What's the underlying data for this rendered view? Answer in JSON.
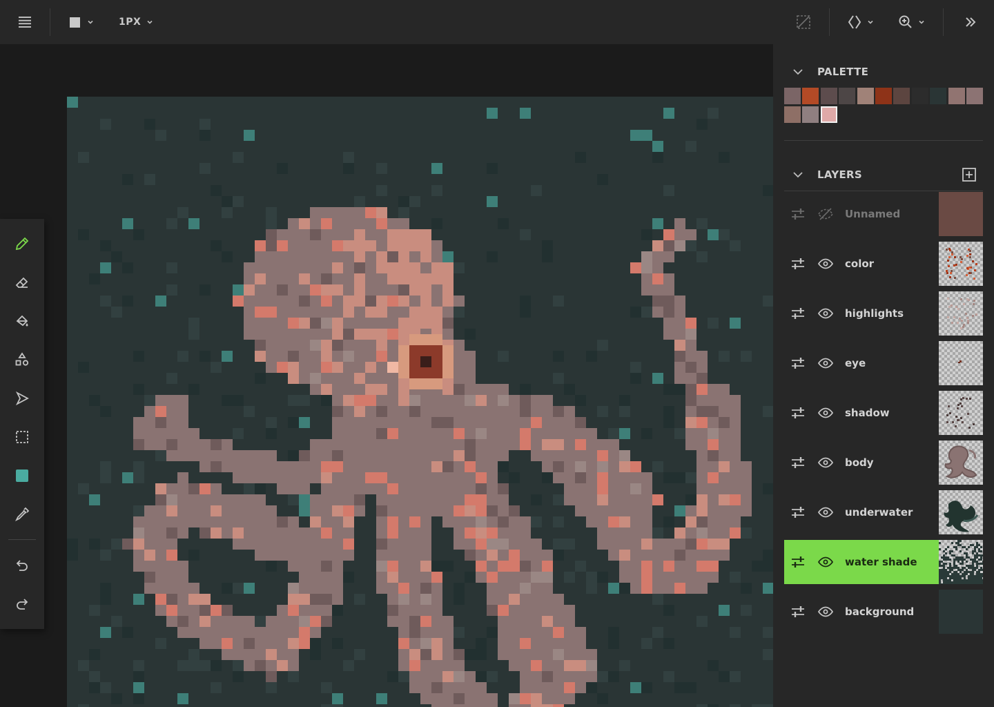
{
  "topbar": {
    "menu_icon": "hamburger-menu-icon",
    "brush_shape_icon": "square-brush-icon",
    "brush_size_label": "1PX",
    "transparency_icon": "transparency-grid-icon",
    "symmetry_icon": "mirror-symmetry-icon",
    "zoom_icon": "zoom-in-icon",
    "collapse_icon": "double-chevron-right-icon"
  },
  "tools": [
    {
      "name": "pencil-tool",
      "icon": "pencil-icon",
      "active": true
    },
    {
      "name": "eraser-tool",
      "icon": "eraser-icon"
    },
    {
      "name": "fill-tool",
      "icon": "paint-bucket-icon"
    },
    {
      "name": "shapes-tool",
      "icon": "shapes-icon"
    },
    {
      "name": "move-tool",
      "icon": "cursor-arrow-icon"
    },
    {
      "name": "selection-tool",
      "icon": "marquee-selection-icon"
    },
    {
      "name": "color-tool",
      "icon": "color-swatch-icon"
    },
    {
      "name": "eyedropper-tool",
      "icon": "eyedropper-icon"
    },
    {
      "name": "undo-button",
      "icon": "undo-icon"
    },
    {
      "name": "redo-button",
      "icon": "redo-icon"
    }
  ],
  "palette": {
    "title": "PALETTE",
    "colors": [
      "#7b6566",
      "#b34a26",
      "#5d4c4d",
      "#4d4646",
      "#a08278",
      "#8e3318",
      "#5c4540",
      "#2c2c2c",
      "#2a3535",
      "#917471",
      "#8c7373",
      "#8e6f66",
      "#8f7f80",
      "#dfa9a8"
    ],
    "selected_index": 13
  },
  "layers": {
    "title": "LAYERS",
    "add_icon": "add-layer-icon",
    "items": [
      {
        "name": "Unnamed",
        "visible": false,
        "thumb": "solid"
      },
      {
        "name": "color",
        "visible": true,
        "thumb": "color"
      },
      {
        "name": "highlights",
        "visible": true,
        "thumb": "highlights"
      },
      {
        "name": "eye",
        "visible": true,
        "thumb": "eye"
      },
      {
        "name": "shadow",
        "visible": true,
        "thumb": "shadow"
      },
      {
        "name": "body",
        "visible": true,
        "thumb": "body"
      },
      {
        "name": "underwater",
        "visible": true,
        "thumb": "underwater"
      },
      {
        "name": "water shade",
        "visible": true,
        "thumb": "watershade",
        "active": true
      },
      {
        "name": "background",
        "visible": true,
        "thumb": "background"
      }
    ]
  },
  "colors": {
    "accent": "#7bd94a",
    "canvas_bg": "#2a3535",
    "octopus_body": "#8a7372",
    "octopus_skin_light": "#c98d7f",
    "octopus_spot": "#d47a6b",
    "teal_pixel": "#3e7f78"
  }
}
